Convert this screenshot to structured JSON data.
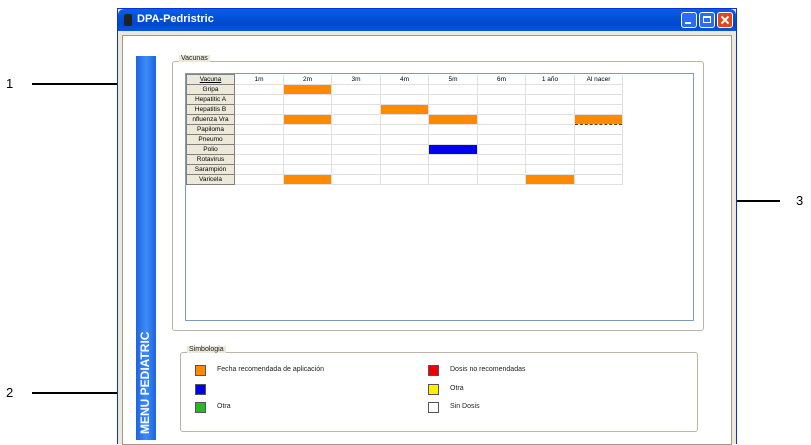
{
  "window": {
    "title": "DPA-Pedristric"
  },
  "side_menu": {
    "label": "MENU  PEDIATRIC"
  },
  "vaccines": {
    "group_label": "Vacunas",
    "columns": [
      "Vacuna",
      "1m",
      "2m",
      "3m",
      "4m",
      "5m",
      "6m",
      "1 año",
      "Al nacer"
    ],
    "rows": [
      {
        "name": "Gripa",
        "cells": [
          "",
          "orange",
          "",
          "",
          "",
          "",
          "",
          ""
        ]
      },
      {
        "name": "Hepatitic A",
        "cells": [
          "",
          "",
          "",
          "",
          "",
          "",
          "",
          ""
        ]
      },
      {
        "name": "Hepatitis B",
        "cells": [
          "",
          "",
          "",
          "orange",
          "",
          "",
          "",
          ""
        ]
      },
      {
        "name": "nfluenza Vra",
        "cells": [
          "",
          "orange",
          "",
          "",
          "orange",
          "",
          "",
          "dashed"
        ]
      },
      {
        "name": "Papiloma",
        "cells": [
          "",
          "",
          "",
          "",
          "",
          "",
          "",
          ""
        ]
      },
      {
        "name": "Pneumo",
        "cells": [
          "",
          "",
          "",
          "",
          "",
          "",
          "",
          ""
        ]
      },
      {
        "name": "Polio",
        "cells": [
          "",
          "",
          "",
          "",
          "blue",
          "",
          "",
          ""
        ]
      },
      {
        "name": "Rotavirus",
        "cells": [
          "",
          "",
          "",
          "",
          "",
          "",
          "",
          ""
        ]
      },
      {
        "name": "Sarampión",
        "cells": [
          "",
          "",
          "",
          "",
          "",
          "",
          "",
          ""
        ]
      },
      {
        "name": "Varicela",
        "cells": [
          "",
          "orange",
          "",
          "",
          "",
          "",
          "orange",
          ""
        ]
      }
    ]
  },
  "legend": {
    "group_label": "Simbologia",
    "items": [
      {
        "label": "Fecha  recomendada de aplicación",
        "color": "#ff8a00"
      },
      {
        "label": "",
        "color": "#0000ee"
      },
      {
        "label": "Otra",
        "color": "#22bb22"
      },
      {
        "label": "Dosis no recomendadas",
        "color": "#ee0000"
      },
      {
        "label": "Otra",
        "color": "#ffee00"
      },
      {
        "label": "Sin Dosis",
        "color": "#ffffff"
      }
    ]
  },
  "callouts": [
    "1",
    "2",
    "3"
  ],
  "colors": {
    "orange": "#ff8a00",
    "blue": "#0000ee",
    "titlebar": "#0251d8"
  }
}
